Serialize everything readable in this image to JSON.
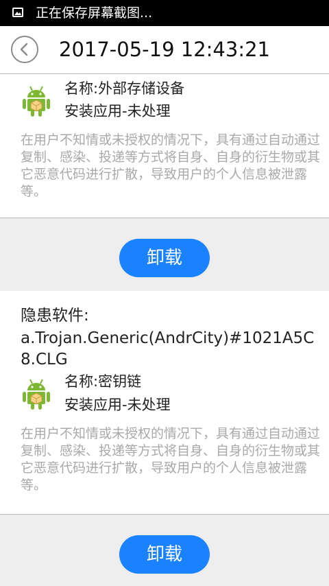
{
  "statusbar": {
    "notification_text": "正在保存屏幕截图...",
    "icon": "image-icon"
  },
  "header": {
    "back_icon": "chevron-left-icon",
    "title": "2017-05-19 12:43:21"
  },
  "threats": [
    {
      "app_name": "名称:外部存储设备",
      "status": "安装应用-未处理",
      "description": "在用户不知情或未授权的情况下，具有通过自动通过复制、感染、投递等方式将自身、自身的衍生物或其它恶意代码进行扩散，导致用户的个人信息被泄露等。",
      "button_label": "卸载"
    },
    {
      "threat_label": "隐患软件:",
      "threat_name": "a.Trojan.Generic(AndrCity)#1021A5C8.CLG",
      "app_name": "名称:密钥链",
      "status": "安装应用-未处理",
      "description": "在用户不知情或未授权的情况下，具有通过自动通过复制、感染、投递等方式将自身、自身的衍生物或其它恶意代码进行扩散，导致用户的个人信息被泄露等。",
      "button_label": "卸载"
    }
  ],
  "colors": {
    "accent": "#1a82ff",
    "description_text": "#a9a9a9",
    "button_area_bg": "#eeeeee",
    "statusbar_bg": "#000000",
    "android_green": "#7cb832"
  }
}
